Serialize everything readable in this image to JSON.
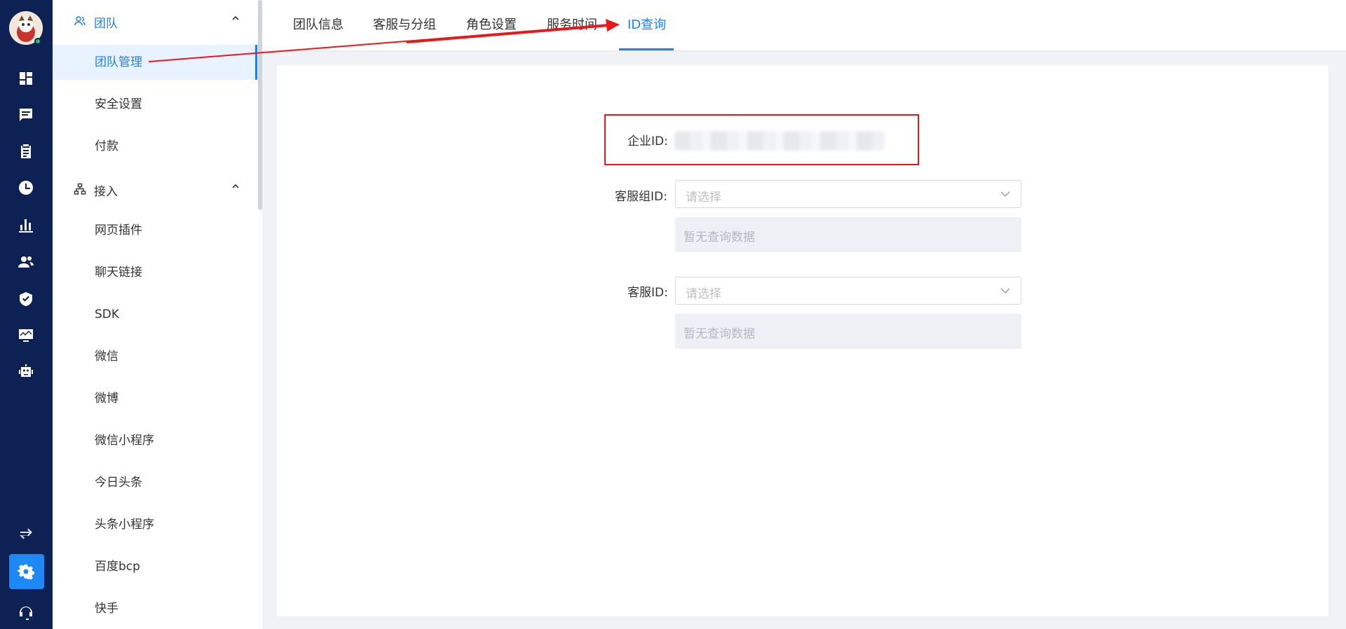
{
  "rail": {
    "icons": [
      "dashboard-icon",
      "message-icon",
      "clipboard-icon",
      "clock-icon",
      "bar-chart-icon",
      "users-icon",
      "shield-icon",
      "monitor-chart-icon",
      "robot-icon",
      "switch-icon",
      "settings-icon",
      "headset-icon"
    ],
    "active_icon": "settings-icon",
    "online_status_color": "#22c55e"
  },
  "sidebar": {
    "groups": [
      {
        "label": "团队",
        "icon": "team-icon",
        "items": [
          {
            "label": "团队管理",
            "active": true
          },
          {
            "label": "安全设置"
          },
          {
            "label": "付款"
          }
        ]
      },
      {
        "label": "接入",
        "icon": "network-icon",
        "items": [
          {
            "label": "网页插件"
          },
          {
            "label": "聊天链接"
          },
          {
            "label": "SDK"
          },
          {
            "label": "微信"
          },
          {
            "label": "微博"
          },
          {
            "label": "微信小程序"
          },
          {
            "label": "今日头条"
          },
          {
            "label": "头条小程序"
          },
          {
            "label": "百度bcp"
          },
          {
            "label": "快手"
          }
        ]
      }
    ]
  },
  "tabs": [
    {
      "label": "团队信息"
    },
    {
      "label": "客服与分组"
    },
    {
      "label": "角色设置"
    },
    {
      "label": "服务时间"
    },
    {
      "label": "ID查询",
      "active": true
    }
  ],
  "form": {
    "enterprise_id_label": "企业ID:",
    "group_id_label": "客服组ID:",
    "group_id_placeholder": "请选择",
    "group_id_empty": "暂无查询数据",
    "agent_id_label": "客服ID:",
    "agent_id_placeholder": "请选择",
    "agent_id_empty": "暂无查询数据"
  },
  "colors": {
    "rail_bg": "#0e2154",
    "accent": "#1e80f0",
    "annotation_red": "#e8181b"
  }
}
